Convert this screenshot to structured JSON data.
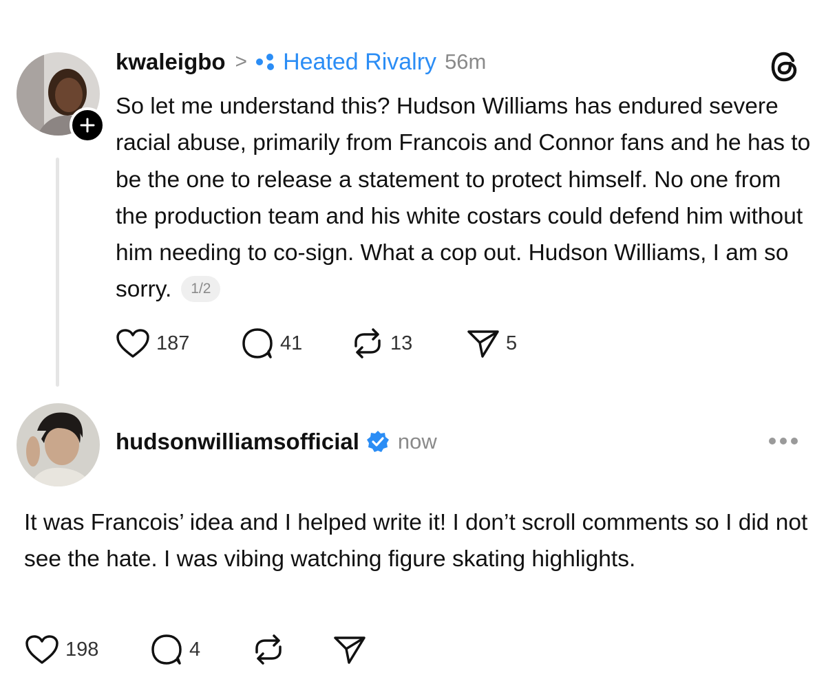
{
  "post1": {
    "username": "kwaleigbo",
    "chevron": ">",
    "community": "Heated Rivalry",
    "time": "56m",
    "text": "So let me understand this? Hudson Williams has endured severe racial abuse, primarily from Francois and Connor fans and he has to be the one to release a statement to protect himself. No one from the production team and his white costars could defend him without him needing to co-sign. What a cop out. Hudson Williams, I am so sorry.",
    "page_indicator": "1/2",
    "likes": "187",
    "comments": "41",
    "reposts": "13",
    "shares": "5"
  },
  "post2": {
    "username": "hudsonwilliamsofficial",
    "time": "now",
    "text": "It was Francois’ idea and I helped write it!  I don’t scroll comments so I did not see the hate. I was vibing watching figure skating highlights.",
    "likes": "198",
    "comments": "4"
  },
  "icons": {
    "community": "community-dots-icon",
    "app": "threads-logo-icon",
    "follow": "plus-icon",
    "like": "heart-icon",
    "comment": "comment-bubble-icon",
    "repost": "repost-icon",
    "share": "send-icon",
    "verified": "verified-badge-icon",
    "more": "more-icon"
  },
  "colors": {
    "accent": "#2b8df5",
    "muted": "#8a8a8a",
    "text": "#111111"
  }
}
